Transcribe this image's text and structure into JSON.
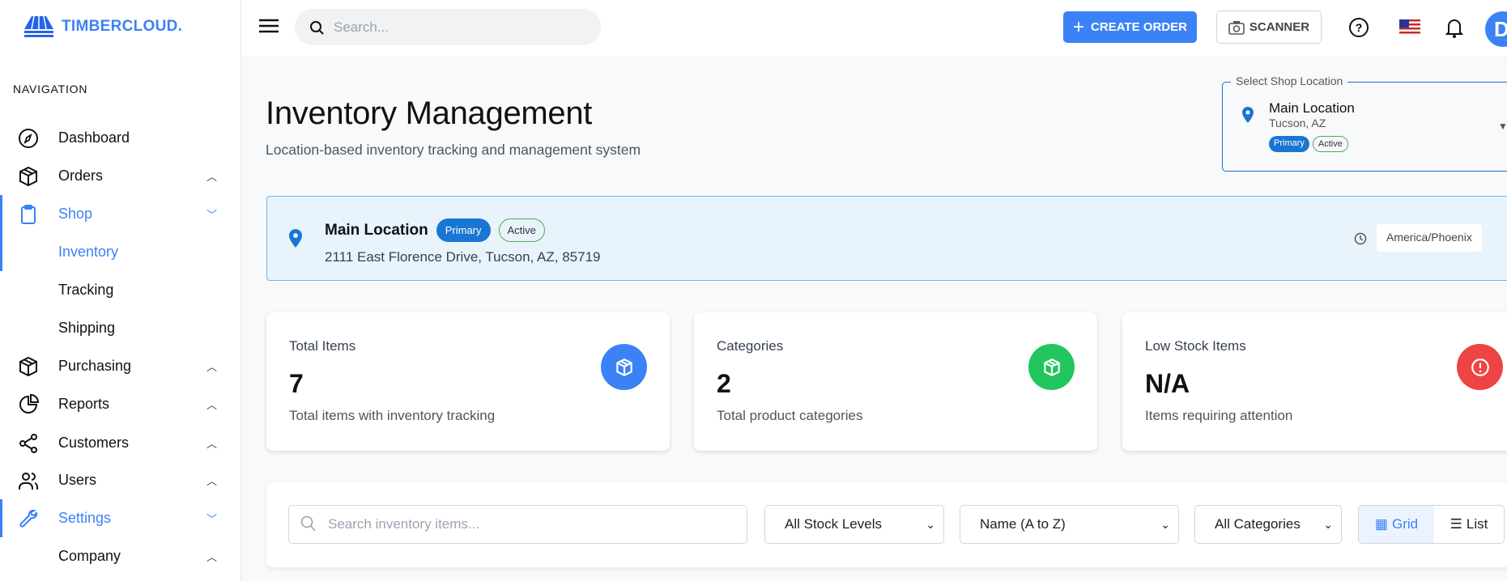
{
  "brand": {
    "name": "TIMBERCLOUD.",
    "color": "#3b82f6"
  },
  "sidebar": {
    "section_label": "NAVIGATION",
    "items": [
      {
        "label": "Dashboard",
        "icon": "compass-icon",
        "chevron": ""
      },
      {
        "label": "Orders",
        "icon": "package-icon",
        "chevron": "^"
      },
      {
        "label": "Shop",
        "icon": "clipboard-icon",
        "chevron": "v",
        "active": true
      },
      {
        "label": "Inventory",
        "icon": "",
        "chevron": "",
        "active": true
      },
      {
        "label": "Tracking",
        "icon": "",
        "chevron": ""
      },
      {
        "label": "Shipping",
        "icon": "",
        "chevron": ""
      },
      {
        "label": "Purchasing",
        "icon": "package-icon",
        "chevron": "^"
      },
      {
        "label": "Reports",
        "icon": "pie-chart-icon",
        "chevron": "^"
      },
      {
        "label": "Customers",
        "icon": "share-icon",
        "chevron": "^"
      },
      {
        "label": "Users",
        "icon": "users-icon",
        "chevron": "^"
      },
      {
        "label": "Settings",
        "icon": "wrench-icon",
        "chevron": "v",
        "active": true
      },
      {
        "label": "Company",
        "icon": "",
        "chevron": "^"
      }
    ]
  },
  "header": {
    "search_placeholder": "Search...",
    "create_order": "CREATE ORDER",
    "scanner": "SCANNER",
    "avatar_initial": "D"
  },
  "page": {
    "title": "Inventory Management",
    "subtitle": "Location-based inventory tracking and management system"
  },
  "location_select": {
    "legend": "Select Shop Location",
    "name": "Main Location",
    "city": "Tucson, AZ",
    "badges": [
      "Primary",
      "Active"
    ]
  },
  "banner": {
    "name": "Main Location",
    "badges": [
      "Primary",
      "Active"
    ],
    "address": "2111 East Florence Drive, Tucson, AZ, 85719",
    "timezone": "America/Phoenix"
  },
  "stats": [
    {
      "title": "Total Items",
      "value": "7",
      "desc": "Total items with inventory tracking",
      "color": "#3b82f6",
      "icon": "cube-icon"
    },
    {
      "title": "Categories",
      "value": "2",
      "desc": "Total product categories",
      "color": "#22c55e",
      "icon": "cube-icon"
    },
    {
      "title": "Low Stock Items",
      "value": "N/A",
      "desc": "Items requiring attention",
      "color": "#ef4444",
      "icon": "alert-circle-icon"
    }
  ],
  "filters": {
    "search_placeholder": "Search inventory items...",
    "stock": "All Stock Levels",
    "sort": "Name (A to Z)",
    "category": "All Categories",
    "grid": "Grid",
    "list": "List",
    "view_selected": "Grid"
  }
}
